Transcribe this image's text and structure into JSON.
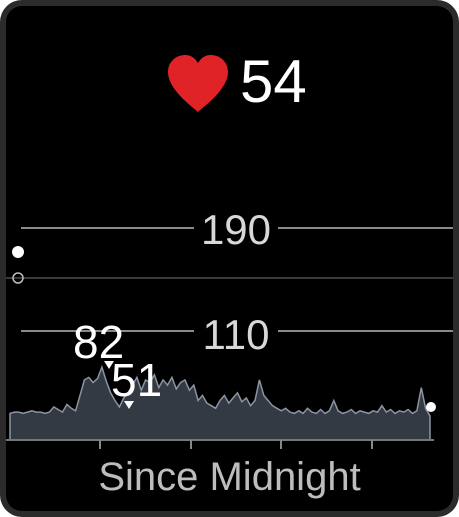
{
  "current_heart_rate": "54",
  "heart_icon": "heart-icon",
  "chart_data": {
    "type": "area",
    "y_ticks": [
      "190",
      "110"
    ],
    "max_label": "82",
    "min_label": "51",
    "series": [
      {
        "values": [
          46,
          47,
          47,
          46,
          47,
          48,
          47,
          47,
          46,
          47,
          51,
          49,
          47,
          53,
          50,
          48,
          60,
          72,
          74,
          70,
          73,
          82,
          71,
          62,
          56,
          51,
          58,
          62,
          68,
          74,
          64,
          72,
          70,
          76,
          66,
          72,
          68,
          74,
          65,
          70,
          72,
          64,
          68,
          56,
          60,
          54,
          52,
          50,
          56,
          60,
          54,
          58,
          62,
          55,
          58,
          52,
          56,
          72,
          60,
          56,
          52,
          50,
          48,
          50,
          47,
          46,
          48,
          46,
          50,
          47,
          46,
          49,
          46,
          48,
          56,
          48,
          46,
          47,
          49,
          46,
          48,
          47,
          46,
          48,
          47,
          52,
          47,
          49,
          46,
          48,
          47,
          49,
          46,
          48,
          66,
          50,
          44
        ]
      }
    ]
  },
  "page_dots": [
    "active",
    "inactive"
  ],
  "footer": {
    "label": "Since Midnight"
  }
}
